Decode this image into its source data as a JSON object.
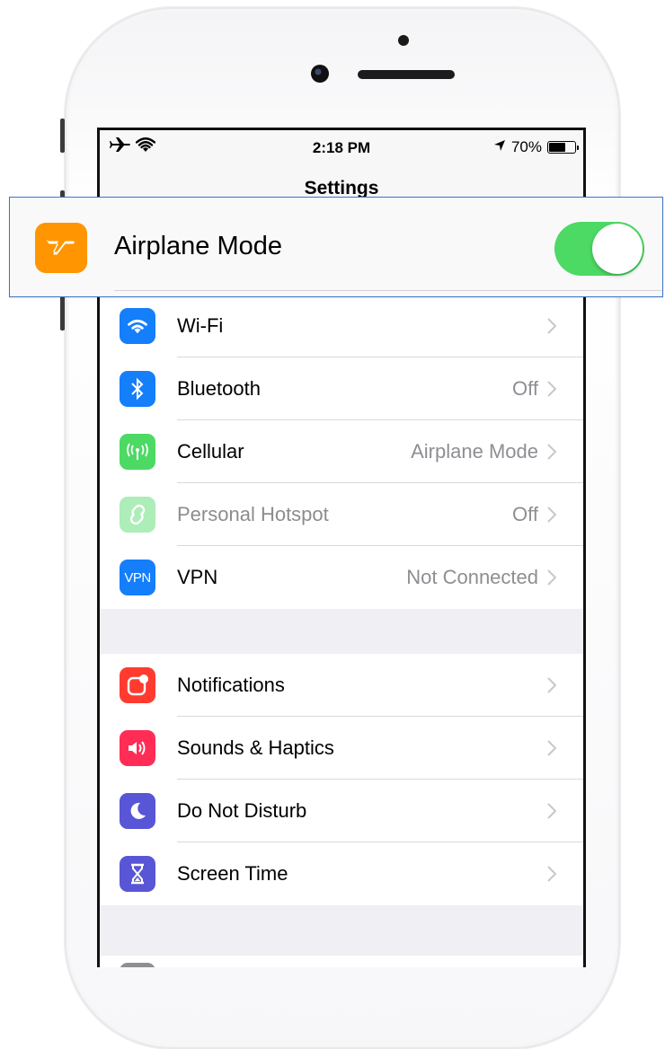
{
  "status_bar": {
    "time": "2:18 PM",
    "battery": "70%",
    "battery_level": 0.7
  },
  "nav": {
    "title": "Settings"
  },
  "airplane": {
    "label": "Airplane Mode",
    "enabled": true,
    "icon": "airplane-icon",
    "color": "#FF9500"
  },
  "rows": [
    {
      "label": "Wi-Fi",
      "value": "",
      "icon": "wifi-icon",
      "color": "#147EFB"
    },
    {
      "label": "Bluetooth",
      "value": "Off",
      "icon": "bluetooth-icon",
      "color": "#147EFB"
    },
    {
      "label": "Cellular",
      "value": "Airplane Mode",
      "icon": "cellular-icon",
      "color": "#4CD964"
    },
    {
      "label": "Personal Hotspot",
      "value": "Off",
      "icon": "hotspot-icon",
      "color": "#4CD964"
    },
    {
      "label": "VPN",
      "value": "Not Connected",
      "icon": "vpn-icon",
      "color": "#147EFB",
      "icon_text": "VPN"
    }
  ],
  "rows2": [
    {
      "label": "Notifications",
      "icon": "notifications-icon",
      "color": "#FF3B30"
    },
    {
      "label": "Sounds & Haptics",
      "icon": "sounds-icon",
      "color": "#FF2D55"
    },
    {
      "label": "Do Not Disturb",
      "icon": "moon-icon",
      "color": "#5856D6"
    },
    {
      "label": "Screen Time",
      "icon": "hourglass-icon",
      "color": "#5856D6"
    }
  ]
}
